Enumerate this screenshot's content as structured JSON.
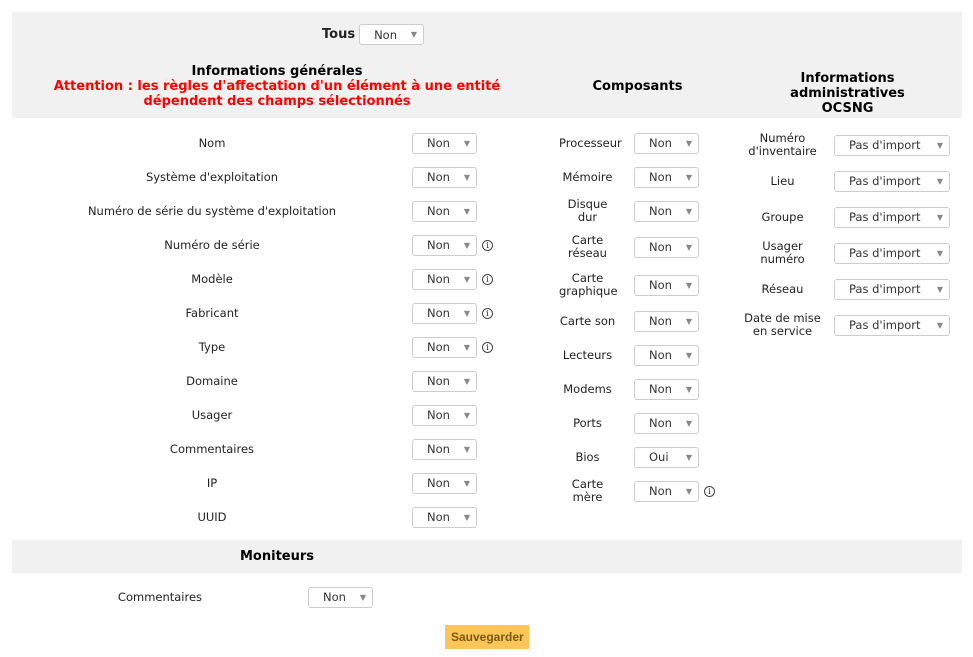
{
  "tous": {
    "label": "Tous",
    "value": "Non"
  },
  "general": {
    "title": "Informations générales",
    "warning": "Attention : les règles d'affectation d'un élément à une entité dépendent des champs sélectionnés",
    "items": [
      {
        "label": "Nom",
        "value": "Non",
        "info": false
      },
      {
        "label": "Système d'exploitation",
        "value": "Non",
        "info": false
      },
      {
        "label": "Numéro de série du système d'exploitation",
        "value": "Non",
        "info": false
      },
      {
        "label": "Numéro de série",
        "value": "Non",
        "info": true
      },
      {
        "label": "Modèle",
        "value": "Non",
        "info": true
      },
      {
        "label": "Fabricant",
        "value": "Non",
        "info": true
      },
      {
        "label": "Type",
        "value": "Non",
        "info": true
      },
      {
        "label": "Domaine",
        "value": "Non",
        "info": false
      },
      {
        "label": "Usager",
        "value": "Non",
        "info": false
      },
      {
        "label": "Commentaires",
        "value": "Non",
        "info": false
      },
      {
        "label": "IP",
        "value": "Non",
        "info": false
      },
      {
        "label": "UUID",
        "value": "Non",
        "info": false
      }
    ]
  },
  "components": {
    "title": "Composants",
    "items": [
      {
        "label": "Processeur",
        "value": "Non",
        "info": false,
        "tall": false
      },
      {
        "label": "Mémoire",
        "value": "Non",
        "info": false,
        "tall": false
      },
      {
        "label": "Disque dur",
        "value": "Non",
        "info": false,
        "tall": false
      },
      {
        "label": "Carte réseau",
        "value": "Non",
        "info": false,
        "tall": true
      },
      {
        "label": "Carte graphique",
        "value": "Non",
        "info": false,
        "tall": true
      },
      {
        "label": "Carte son",
        "value": "Non",
        "info": false,
        "tall": false
      },
      {
        "label": "Lecteurs",
        "value": "Non",
        "info": false,
        "tall": false
      },
      {
        "label": "Modems",
        "value": "Non",
        "info": false,
        "tall": false
      },
      {
        "label": "Ports",
        "value": "Non",
        "info": false,
        "tall": false
      },
      {
        "label": "Bios",
        "value": "Oui",
        "info": false,
        "tall": false
      },
      {
        "label": "Carte mère",
        "value": "Non",
        "info": true,
        "tall": false
      }
    ]
  },
  "admin": {
    "title": "Informations administratives OCSNG",
    "items": [
      {
        "label": "Numéro d'inventaire",
        "value": "Pas d'import"
      },
      {
        "label": "Lieu",
        "value": "Pas d'import"
      },
      {
        "label": "Groupe",
        "value": "Pas d'import"
      },
      {
        "label": "Usager numéro",
        "value": "Pas d'import"
      },
      {
        "label": "Réseau",
        "value": "Pas d'import"
      },
      {
        "label": "Date de mise en service",
        "value": "Pas d'import"
      }
    ]
  },
  "monitors": {
    "title": "Moniteurs",
    "items": [
      {
        "label": "Commentaires",
        "value": "Non"
      }
    ]
  },
  "save_label": "Sauvegarder",
  "colors": {
    "warning": "#ff0000",
    "save": "#fcc55a",
    "band": "#f1f1f1"
  }
}
